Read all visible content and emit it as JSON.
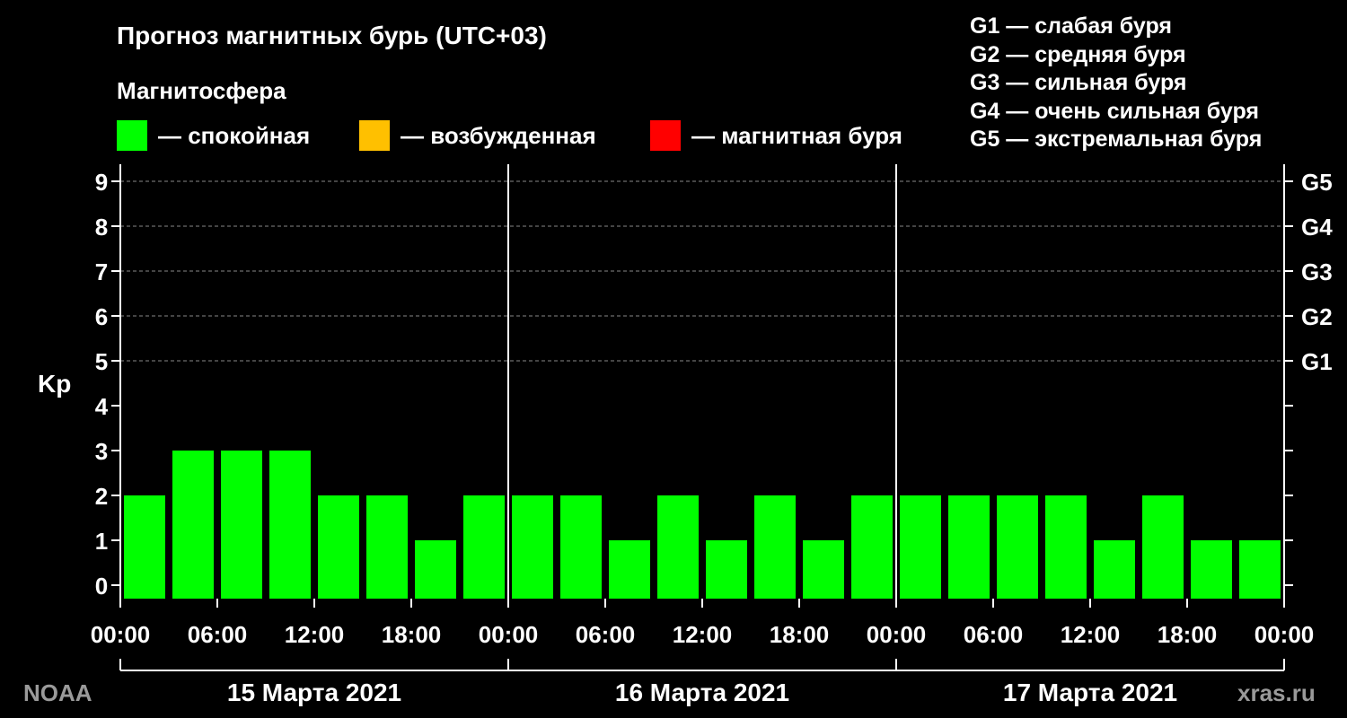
{
  "title": "Прогноз магнитных бурь (UTC+03)",
  "subtitle": "Магнитосфера",
  "legend": [
    {
      "label": "— спокойная",
      "color": "#00ff00"
    },
    {
      "label": "— возбужденная",
      "color": "#ffc000"
    },
    {
      "label": "— магнитная буря",
      "color": "#ff0000"
    }
  ],
  "storm_levels": [
    "G1 — слабая буря",
    "G2 — средняя буря",
    "G3 — сильная буря",
    "G4 — очень сильная буря",
    "G5 — экстремальная буря"
  ],
  "source_left": "NOAA",
  "source_right": "xras.ru",
  "chart_data": {
    "type": "bar",
    "ylabel": "Kp",
    "ylim": [
      0,
      9
    ],
    "yticks": [
      "0",
      "1",
      "2",
      "3",
      "4",
      "5",
      "6",
      "7",
      "8",
      "9"
    ],
    "right_axis_labels": [
      {
        "kp": 5,
        "label": "G1"
      },
      {
        "kp": 6,
        "label": "G2"
      },
      {
        "kp": 7,
        "label": "G3"
      },
      {
        "kp": 8,
        "label": "G4"
      },
      {
        "kp": 9,
        "label": "G5"
      }
    ],
    "xticks": [
      "00:00",
      "06:00",
      "12:00",
      "18:00",
      "00:00",
      "06:00",
      "12:00",
      "18:00",
      "00:00",
      "06:00",
      "12:00",
      "18:00",
      "00:00"
    ],
    "days": [
      "15 Марта 2021",
      "16 Марта 2021",
      "17 Марта 2021"
    ],
    "values": [
      2,
      3,
      3,
      3,
      2,
      2,
      1,
      2,
      2,
      2,
      1,
      2,
      1,
      2,
      1,
      2,
      2,
      2,
      2,
      2,
      1,
      2,
      1,
      1
    ],
    "bar_color": "#00ff00",
    "grid": "dashed at Kp 5–9"
  }
}
